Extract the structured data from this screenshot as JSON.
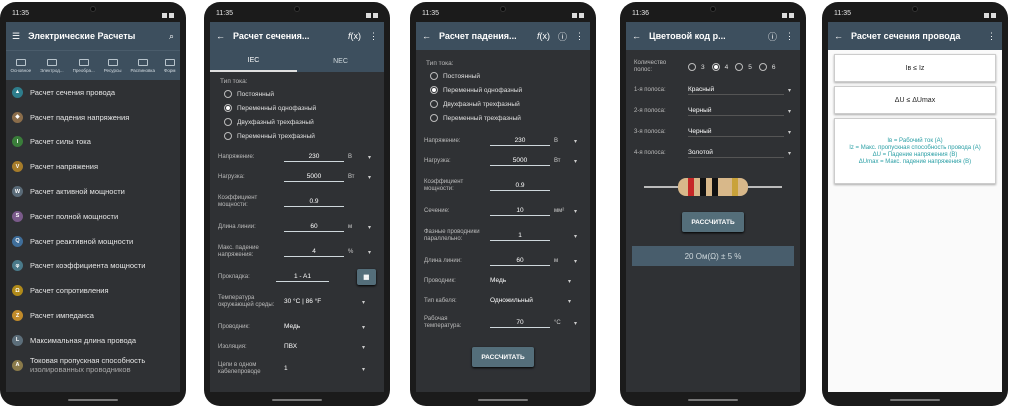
{
  "status_times": [
    "11:35",
    "11:35",
    "11:35",
    "11:36",
    "11:35"
  ],
  "p1": {
    "title": "Электрические Расчеты",
    "categories": [
      "Основное",
      "Электрод...",
      "Преобра...",
      "Ресурсы",
      "Распиновка",
      "Форм"
    ],
    "items": [
      {
        "label": "Расчет сечения провода",
        "color": "#2e7d8c",
        "glyph": "▲"
      },
      {
        "label": "Расчет падения напряжения",
        "color": "#8b6d4a",
        "glyph": "◆"
      },
      {
        "label": "Расчет силы тока",
        "color": "#3a7d3a",
        "glyph": "I"
      },
      {
        "label": "Расчет напряжения",
        "color": "#a67c2a",
        "glyph": "V"
      },
      {
        "label": "Расчет активной мощности",
        "color": "#5a6b78",
        "glyph": "W"
      },
      {
        "label": "Расчет полной мощности",
        "color": "#7a5a8a",
        "glyph": "S"
      },
      {
        "label": "Расчет реактивной мощности",
        "color": "#3f6e9a",
        "glyph": "Q"
      },
      {
        "label": "Расчет коэффициента мощности",
        "color": "#4a7a8a",
        "glyph": "φ"
      },
      {
        "label": "Расчет сопротивления",
        "color": "#b08a1a",
        "glyph": "Ω"
      },
      {
        "label": "Расчет импеданса",
        "color": "#c08a2a",
        "glyph": "Z"
      },
      {
        "label": "Максимальная длина провода",
        "color": "#5c6e7a",
        "glyph": "L"
      },
      {
        "label": "Токовая пропускная способность",
        "color": "#8a7a4a",
        "glyph": "A"
      }
    ],
    "item_last_sub": "изолированных проводников"
  },
  "p2": {
    "title": "Расчет сечения...",
    "tabs": [
      "IEC",
      "NEC"
    ],
    "type_label": "Тип тока:",
    "radios": [
      "Постоянный",
      "Переменный однофазный",
      "Двухфазный трехфазный",
      "Переменный трехфазный"
    ],
    "selected": 1,
    "rows": [
      {
        "label": "Напряжение:",
        "value": "230",
        "unit": "В"
      },
      {
        "label": "Нагрузка:",
        "value": "5000",
        "unit": "Вт"
      },
      {
        "label": "Коэффициент мощности:",
        "value": "0.9",
        "unit": ""
      },
      {
        "label": "Длина линии:",
        "value": "60",
        "unit": "м"
      },
      {
        "label": "Макс. падение напряжения:",
        "value": "4",
        "unit": "%"
      },
      {
        "label": "Прокладка:",
        "value": "1 - A1",
        "unit": ""
      }
    ],
    "temp_label": "Температура окружающей среды:",
    "temp_value": "30 °C | 86 °F",
    "conductor_label": "Проводник:",
    "conductor_value": "Медь",
    "insulation_label": "Изоляция:",
    "insulation_value": "ПВХ",
    "circuits_label": "Цепи в одном кабелепроводе",
    "circuits_value": "1"
  },
  "p3": {
    "title": "Расчет падения...",
    "type_label": "Тип тока:",
    "radios": [
      "Постоянный",
      "Переменный однофазный",
      "Двухфазный трехфазный",
      "Переменный трехфазный"
    ],
    "selected": 1,
    "rows": [
      {
        "label": "Напряжение:",
        "value": "230",
        "unit": "В"
      },
      {
        "label": "Нагрузка:",
        "value": "5000",
        "unit": "Вт"
      },
      {
        "label": "Коэффициент мощности:",
        "value": "0.9",
        "unit": ""
      },
      {
        "label": "Сечение:",
        "value": "10",
        "unit": "мм²"
      },
      {
        "label": "Фазные проводники параллельно:",
        "value": "1",
        "unit": ""
      },
      {
        "label": "Длина линии:",
        "value": "60",
        "unit": "м"
      }
    ],
    "conductor_label": "Проводник:",
    "conductor_value": "Медь",
    "cable_label": "Тип кабеля:",
    "cable_value": "Одножильный",
    "worktemp_label": "Рабочая температура:",
    "worktemp_value": "70",
    "worktemp_unit": "°C",
    "button": "РАССЧИТАТЬ"
  },
  "p4": {
    "title": "Цветовой код р...",
    "count_label": "Количество полос:",
    "counts": [
      "3",
      "4",
      "5",
      "6"
    ],
    "selected": 1,
    "bands": [
      {
        "label": "1-я полоса:",
        "value": "Красный"
      },
      {
        "label": "2-я полоса:",
        "value": "Черный"
      },
      {
        "label": "3-я полоса:",
        "value": "Черный"
      },
      {
        "label": "4-я полоса:",
        "value": "Золотой"
      }
    ],
    "band_colors": [
      "#c62828",
      "#111111",
      "#111111",
      "#c9a23a"
    ],
    "button": "РАССЧИТАТЬ",
    "result": "20 Ом(Ω) ± 5 %"
  },
  "p5": {
    "title": "Расчет сечения провода",
    "card1": "Iв ≤ Iz",
    "card2": "ΔU ≤ ΔUmax",
    "legend": [
      "Iв = Рабочий ток (A)",
      "Iz = Макс. пропускная способность провода (A)",
      "ΔU = Падение напряжения (В)",
      "ΔUmax = Макс. падение напряжения (В)"
    ]
  }
}
